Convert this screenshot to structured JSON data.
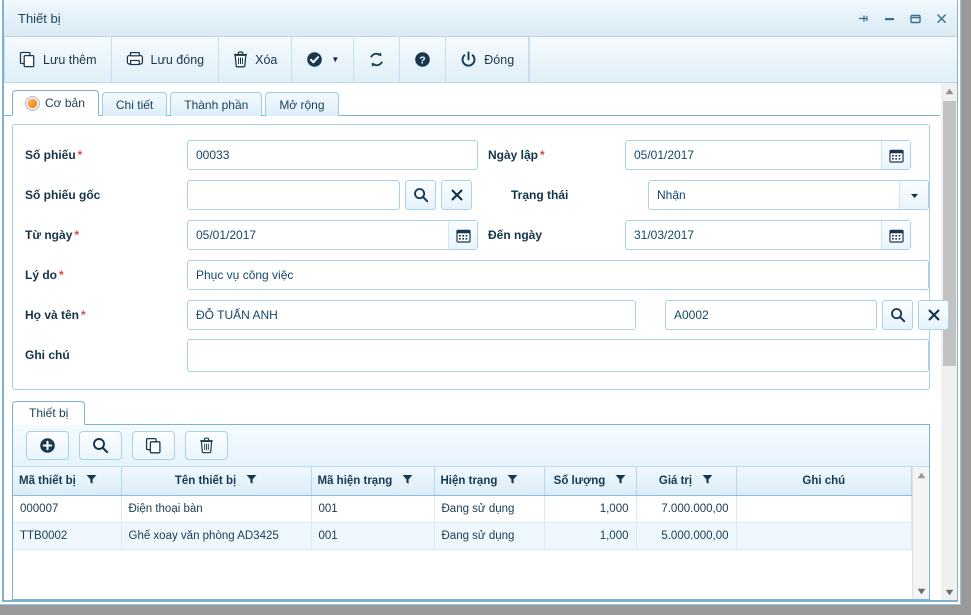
{
  "window": {
    "title": "Thiết bị",
    "controls": [
      {
        "name": "pin-button",
        "glyph": "pin"
      },
      {
        "name": "minimize-button",
        "glyph": "minimize"
      },
      {
        "name": "maximize-button",
        "glyph": "maximize"
      },
      {
        "name": "close-button",
        "glyph": "close"
      }
    ]
  },
  "toolbar": {
    "buttons": [
      {
        "label": "Lưu thêm",
        "icon": "copy-icon"
      },
      {
        "label": "Lưu đóng",
        "icon": "save-close-icon"
      },
      {
        "label": "Xóa",
        "icon": "trash-icon"
      },
      {
        "label": "",
        "icon": "check-circle-icon",
        "caret": "▼"
      },
      {
        "label": "",
        "icon": "refresh-icon"
      },
      {
        "label": "",
        "icon": "help-icon"
      },
      {
        "label": "Đóng",
        "icon": "power-icon"
      }
    ]
  },
  "tabs": [
    {
      "label": "Cơ bản",
      "active": true,
      "icon": "orange-dot-icon"
    },
    {
      "label": "Chi tiết",
      "active": false
    },
    {
      "label": "Thành phần",
      "active": false
    },
    {
      "label": "Mở rộng",
      "active": false
    }
  ],
  "form": {
    "so_phieu": {
      "label": "Số phiếu",
      "required": true,
      "value": "00033"
    },
    "ngay_lap": {
      "label": "Ngày lập",
      "required": true,
      "value": "05/01/2017"
    },
    "so_phieu_goc": {
      "label": "Số phiếu gốc",
      "required": false,
      "value": ""
    },
    "trang_thai": {
      "label": "Trạng thái",
      "required": false,
      "value": "Nhận"
    },
    "tu_ngay": {
      "label": "Từ ngày",
      "required": true,
      "value": "05/01/2017"
    },
    "den_ngay": {
      "label": "Đến ngày",
      "required": false,
      "value": "31/03/2017"
    },
    "ly_do": {
      "label": "Lý do",
      "required": true,
      "value": "Phục vụ công việc"
    },
    "ho_va_ten": {
      "label": "Họ và tên",
      "required": true,
      "value": "ĐỖ TUẤN ANH",
      "code": "A0002"
    },
    "ghi_chu": {
      "label": "Ghi chú",
      "required": false,
      "value": ""
    }
  },
  "grid_section": {
    "tab_label": "Thiết bị",
    "toolbar": [
      {
        "name": "add-button",
        "icon": "plus-circle-icon"
      },
      {
        "name": "search-button",
        "icon": "search-icon"
      },
      {
        "name": "duplicate-button",
        "icon": "copy-icon"
      },
      {
        "name": "delete-button",
        "icon": "trash-icon"
      }
    ],
    "columns": [
      {
        "label": "Mã thiết bị",
        "align": "left"
      },
      {
        "label": "Tên thiết bị",
        "align": "center"
      },
      {
        "label": "Mã hiện trạng",
        "align": "left"
      },
      {
        "label": "Hiện trạng",
        "align": "left"
      },
      {
        "label": "Số lượng",
        "align": "center"
      },
      {
        "label": "Giá trị",
        "align": "center"
      },
      {
        "label": "Ghi chú",
        "align": "center"
      }
    ],
    "rows": [
      {
        "ma_thiet_bi": "000007",
        "ten_thiet_bi": "Điện thoại bàn",
        "ma_hien_trang": "001",
        "hien_trang": "Đang sử dụng",
        "so_luong": "1,000",
        "gia_tri": "7.000.000,00",
        "ghi_chu": ""
      },
      {
        "ma_thiet_bi": "TTB0002",
        "ten_thiet_bi": "Ghế xoay văn phòng AD3425",
        "ma_hien_trang": "001",
        "hien_trang": "Đang sử dụng",
        "so_luong": "1,000",
        "gia_tri": "5.000.000,00",
        "ghi_chu": ""
      }
    ]
  },
  "colors": {
    "accent": "#1b4159",
    "border": "#7fb2cf",
    "field_border": "#a9d2e8",
    "required": "#e04a3a",
    "tab_dot": "#f58b18",
    "row_alt": "#eef7fc"
  }
}
